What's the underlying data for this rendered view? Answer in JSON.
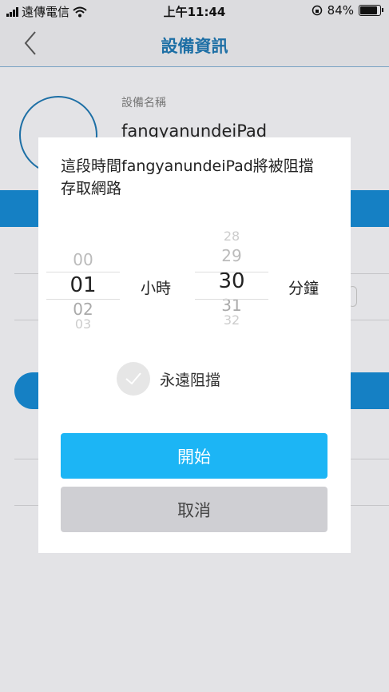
{
  "status_bar": {
    "carrier": "遠傳電信",
    "time": "上午11:44",
    "battery": "84%"
  },
  "nav": {
    "title": "設備資訊"
  },
  "device": {
    "label": "設備名稱",
    "name": "fangyanundeiPad"
  },
  "dialog": {
    "message": "這段時間fangyanundeiPad將被阻擋存取網路",
    "hours": {
      "items": [
        "00",
        "01",
        "02",
        "03"
      ],
      "selected": "01",
      "unit": "小時"
    },
    "minutes": {
      "items": [
        "28",
        "29",
        "30",
        "31",
        "32"
      ],
      "selected": "30",
      "unit": "分鐘"
    },
    "always_block_label": "永遠阻擋",
    "always_block_checked": false,
    "start_label": "開始",
    "cancel_label": "取消"
  },
  "colors": {
    "accent": "#1d6fa5",
    "start_button": "#1cb5f5",
    "cancel_button": "#cfcfd3"
  }
}
